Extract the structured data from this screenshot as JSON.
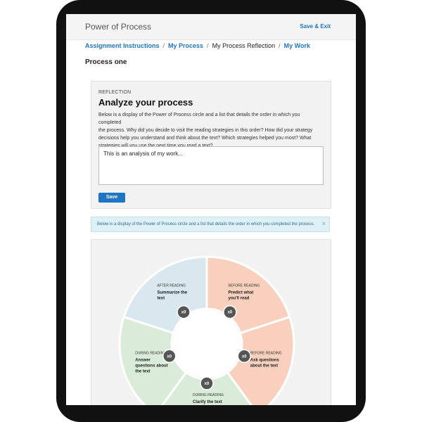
{
  "app": {
    "title": "Power of Process",
    "save_exit": "Save & Exit"
  },
  "breadcrumb": {
    "items": [
      {
        "label": "Assignment Instructions",
        "link": true
      },
      {
        "label": "My Process",
        "link": true
      },
      {
        "label": "My Process Reflection",
        "link": false
      },
      {
        "label": "My Work",
        "link": true
      }
    ],
    "separator": "/"
  },
  "page": {
    "title": "Process one"
  },
  "reflection": {
    "label": "REFLECTION",
    "heading": "Analyze your process",
    "prompt_lines": [
      "Below is a display of the Power of Process circle and a list that details the order in which you completed",
      "the process. Why did you decide to visit the reading strategies in this order? How did your strategy",
      "decisions help you understand and think about the text? Which strategies helped you most? What",
      "strategies will you use the next time you read a text?"
    ],
    "answer": "This is an analysis of my work...",
    "save_label": "Save"
  },
  "info_banner": {
    "text": "Below is a display of the Power of Process circle and a list that details the order in which you completed the process.",
    "close": "×"
  },
  "wheel": {
    "segments": [
      {
        "stage": "AFTER READING",
        "title_lines": [
          "Summarize the",
          "text"
        ],
        "color": "#d9e7ef",
        "count": "x0"
      },
      {
        "stage": "BEFORE READING",
        "title_lines": [
          "Predict what",
          "you'll read"
        ],
        "color": "#f8d0bd",
        "count": "x0"
      },
      {
        "stage": "BEFORE READING",
        "title_lines": [
          "Ask questions",
          "about the text"
        ],
        "color": "#f8d0bd",
        "count": "x0"
      },
      {
        "stage": "DURING READING",
        "title_lines": [
          "Clarify the text"
        ],
        "color": "#d9ecd9",
        "count": "x0"
      },
      {
        "stage": "DURING READING",
        "title_lines": [
          "Answer",
          "questions about",
          "the text"
        ],
        "color": "#d9ecd9",
        "count": "x0"
      }
    ],
    "badge_color": "#555555"
  },
  "colors": {
    "accent": "#1f74c4",
    "banner": "#dff1f7"
  }
}
